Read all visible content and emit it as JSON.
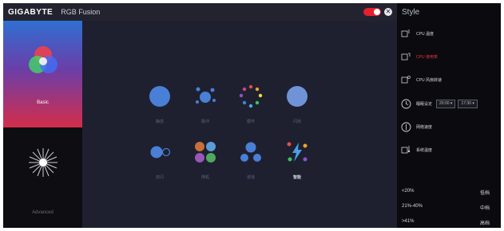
{
  "app": {
    "brand": "GIGABYTE",
    "title": "RGB Fusion"
  },
  "modes": [
    {
      "label": "Basic"
    },
    {
      "label": "Advanced"
    }
  ],
  "effects": [
    {
      "label": "静态",
      "icon": "static-icon"
    },
    {
      "label": "脉冲",
      "icon": "pulse-icon"
    },
    {
      "label": "循环",
      "icon": "cycle-icon"
    },
    {
      "label": "闪烁",
      "icon": "flash-icon"
    },
    {
      "label": "双闪",
      "icon": "double-flash-icon"
    },
    {
      "label": "随机",
      "icon": "random-icon"
    },
    {
      "label": "波浪",
      "icon": "wave-icon"
    },
    {
      "label": "智能",
      "icon": "intelligent-icon"
    }
  ],
  "style_panel": {
    "title": "Style",
    "items": [
      {
        "label": "CPU 温度"
      },
      {
        "label": "CPU 使用率"
      },
      {
        "label": "CPU 风扇转速"
      },
      {
        "label": "睡眠设定",
        "from": "20:00",
        "to": "17:30"
      },
      {
        "label": "网络速度"
      },
      {
        "label": "系统温度"
      }
    ],
    "thresholds": [
      {
        "range": "<20%",
        "level": "低档"
      },
      {
        "range": "21%-40%",
        "level": "中档"
      },
      {
        "range": ">41%",
        "level": "高档"
      }
    ]
  },
  "colors": {
    "accent": "#e61f2e",
    "effect_blue": "#4a7fd6",
    "panel_bg": "#0b0b0f"
  }
}
